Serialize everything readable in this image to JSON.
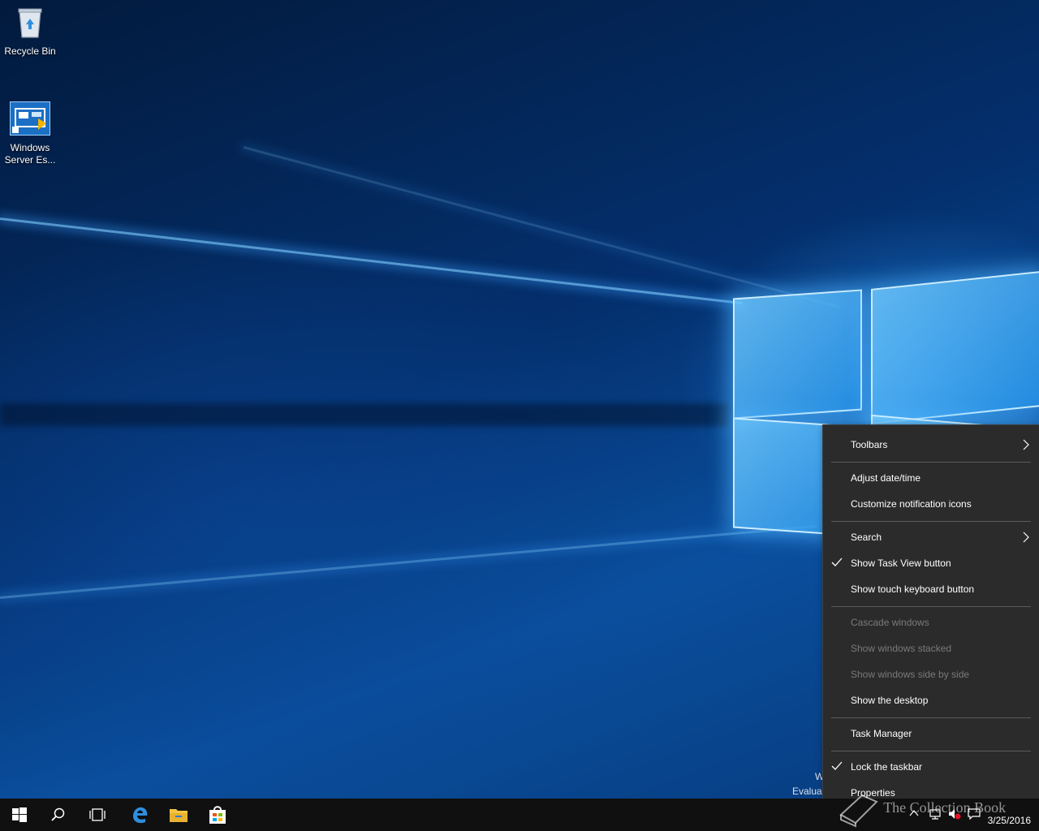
{
  "desktop": {
    "icons": [
      {
        "label": "Recycle Bin"
      },
      {
        "label": "Windows\nServer Es..."
      }
    ],
    "watermark_line1": "W",
    "watermark_line2": "Evaluat"
  },
  "context_menu": {
    "items": [
      {
        "label": "Toolbars",
        "submenu": true
      },
      {
        "label": "Adjust date/time"
      },
      {
        "label": "Customize notification icons"
      },
      {
        "label": "Search",
        "submenu": true
      },
      {
        "label": "Show Task View button",
        "checked": true
      },
      {
        "label": "Show touch keyboard button"
      },
      {
        "label": "Cascade windows",
        "disabled": true
      },
      {
        "label": "Show windows stacked",
        "disabled": true
      },
      {
        "label": "Show windows side by side",
        "disabled": true
      },
      {
        "label": "Show the desktop"
      },
      {
        "label": "Task Manager"
      },
      {
        "label": "Lock the taskbar",
        "checked": true
      },
      {
        "label": "Properties"
      }
    ]
  },
  "taskbar": {
    "clock_date": "3/25/2016",
    "overlay_text": "The Collection Book",
    "pinned": [
      "start-icon",
      "search-icon",
      "task-view-icon",
      "edge-icon",
      "file-explorer-icon",
      "store-icon"
    ]
  },
  "colors": {
    "menu_bg": "#2b2b2b",
    "taskbar_bg": "#101010",
    "accent": "#0a78d7"
  }
}
